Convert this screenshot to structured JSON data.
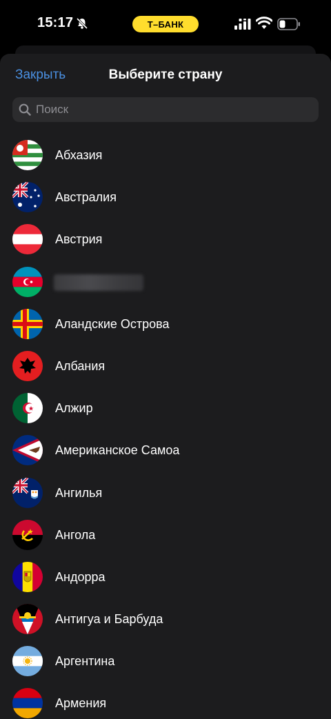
{
  "status_bar": {
    "time": "15:17",
    "bank_pill": "Т–БАНК",
    "icons": [
      "bell-slash-icon",
      "signal-icon",
      "wifi-icon",
      "battery-icon"
    ]
  },
  "sheet": {
    "close_label": "Закрыть",
    "title": "Выберите страну",
    "search_placeholder": "Поиск"
  },
  "countries": [
    {
      "name": "Абхазия",
      "flag": "abkhazia-flag-icon"
    },
    {
      "name": "Австралия",
      "flag": "australia-flag-icon"
    },
    {
      "name": "Австрия",
      "flag": "austria-flag-icon"
    },
    {
      "name": "",
      "flag": "azerbaijan-flag-icon",
      "redacted": true
    },
    {
      "name": "Аландские Острова",
      "flag": "aland-flag-icon"
    },
    {
      "name": "Албания",
      "flag": "albania-flag-icon"
    },
    {
      "name": "Алжир",
      "flag": "algeria-flag-icon"
    },
    {
      "name": "Американское Самоа",
      "flag": "american-samoa-flag-icon"
    },
    {
      "name": "Ангилья",
      "flag": "anguilla-flag-icon"
    },
    {
      "name": "Ангола",
      "flag": "angola-flag-icon"
    },
    {
      "name": "Андорра",
      "flag": "andorra-flag-icon"
    },
    {
      "name": "Антигуа и Барбуда",
      "flag": "antigua-flag-icon"
    },
    {
      "name": "Аргентина",
      "flag": "argentina-flag-icon"
    },
    {
      "name": "Армения",
      "flag": "armenia-flag-icon"
    }
  ],
  "colors": {
    "accent": "#4a90e2",
    "bank_yellow": "#ffdd2d",
    "sheet_bg": "#1c1c1e",
    "search_bg": "#2c2c2e"
  }
}
